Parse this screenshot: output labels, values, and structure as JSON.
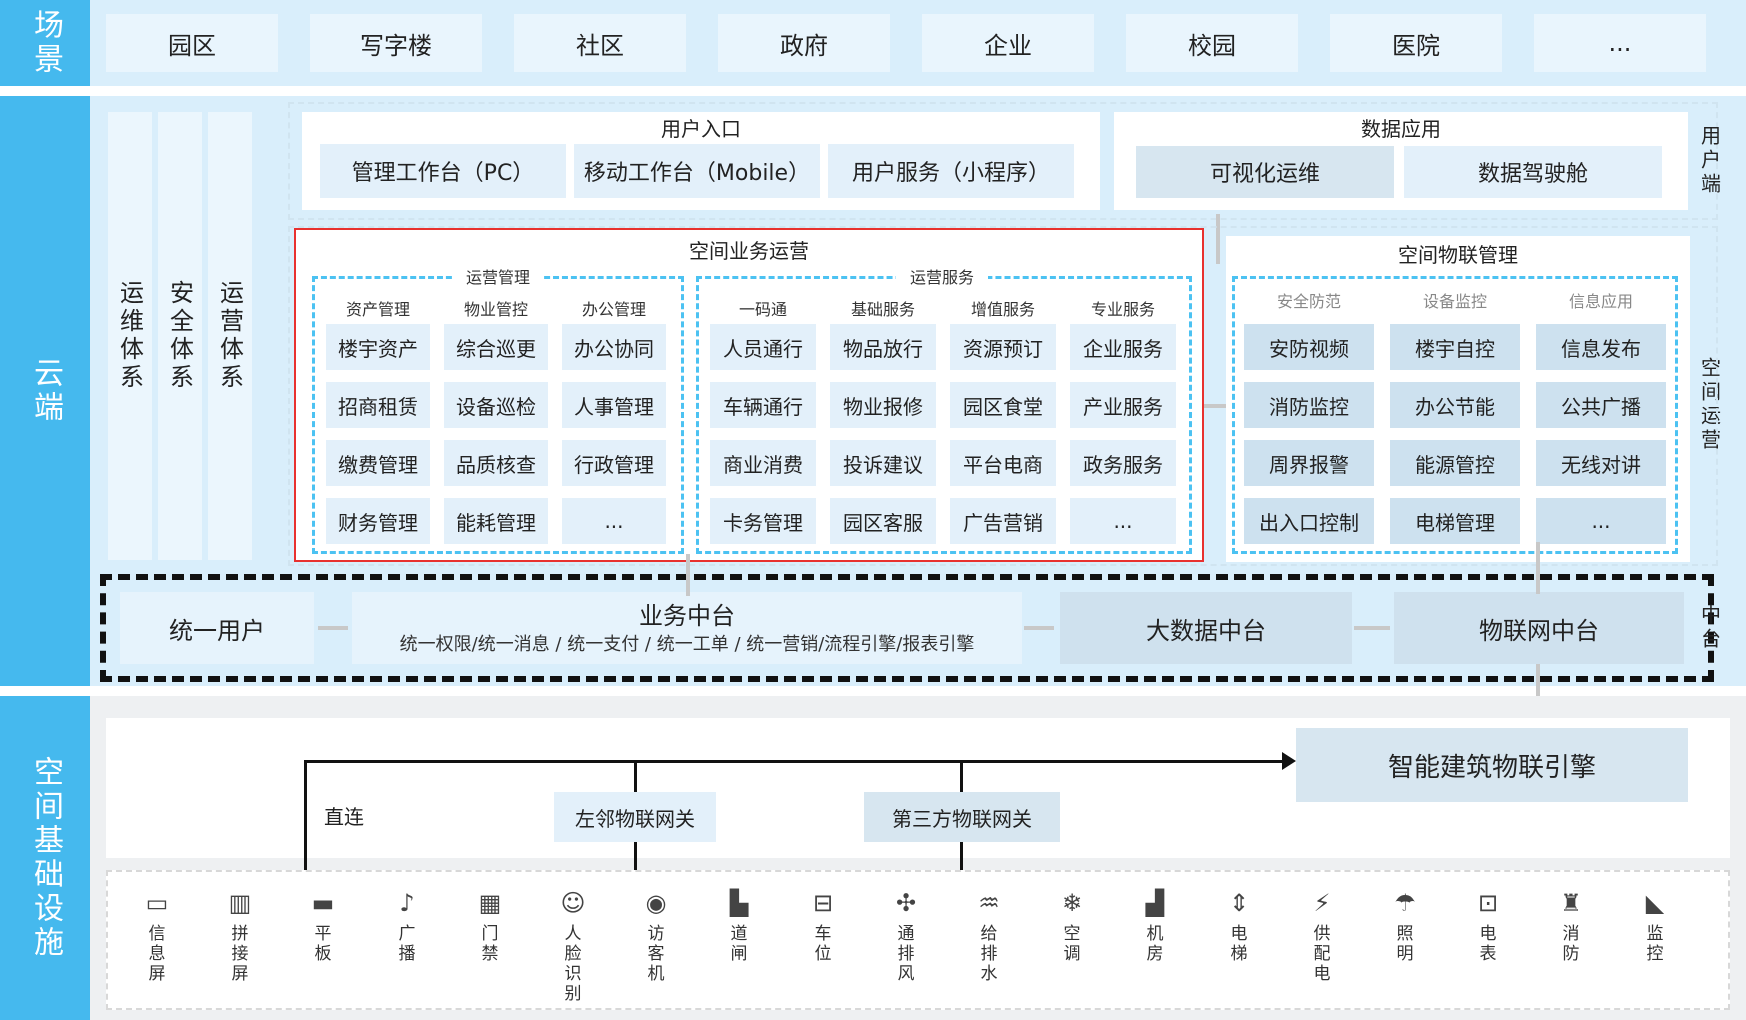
{
  "categories": {
    "scene": "场景",
    "cloud": "云端",
    "infra": "空间基础设施"
  },
  "scenes": [
    "园区",
    "写字楼",
    "社区",
    "政府",
    "企业",
    "校园",
    "医院",
    "..."
  ],
  "systems": [
    "运维体系",
    "安全体系",
    "运营体系"
  ],
  "user_entry": {
    "title": "用户入口",
    "items": [
      "管理工作台（PC）",
      "移动工作台（Mobile）",
      "用户服务（小程序）"
    ]
  },
  "data_app": {
    "title": "数据应用",
    "items": [
      "可视化运维",
      "数据驾驶舱"
    ]
  },
  "side_labels": {
    "user_end": "用户端",
    "space_ops": "空间运营",
    "middle": "中台"
  },
  "space_business": {
    "title": "空间业务运营",
    "ops_mgmt": {
      "title": "运营管理",
      "columns": [
        {
          "header": "资产管理",
          "items": [
            "楼宇资产",
            "招商租赁",
            "缴费管理",
            "财务管理"
          ]
        },
        {
          "header": "物业管控",
          "items": [
            "综合巡更",
            "设备巡检",
            "品质核查",
            "能耗管理"
          ]
        },
        {
          "header": "办公管理",
          "items": [
            "办公协同",
            "人事管理",
            "行政管理",
            "..."
          ]
        }
      ]
    },
    "ops_service": {
      "title": "运营服务",
      "columns": [
        {
          "header": "一码通",
          "items": [
            "人员通行",
            "车辆通行",
            "商业消费",
            "卡务管理"
          ]
        },
        {
          "header": "基础服务",
          "items": [
            "物品放行",
            "物业报修",
            "投诉建议",
            "园区客服"
          ]
        },
        {
          "header": "增值服务",
          "items": [
            "资源预订",
            "园区食堂",
            "平台电商",
            "广告营销"
          ]
        },
        {
          "header": "专业服务",
          "items": [
            "企业服务",
            "产业服务",
            "政务服务",
            "..."
          ]
        }
      ]
    }
  },
  "iot_mgmt": {
    "title": "空间物联管理",
    "columns": [
      {
        "header": "安全防范",
        "items": [
          "安防视频",
          "消防监控",
          "周界报警",
          "出入口控制"
        ]
      },
      {
        "header": "设备监控",
        "items": [
          "楼宇自控",
          "办公节能",
          "能源管控",
          "电梯管理"
        ]
      },
      {
        "header": "信息应用",
        "items": [
          "信息发布",
          "公共广播",
          "无线对讲",
          "..."
        ]
      }
    ]
  },
  "middle": {
    "unified_user": "统一用户",
    "biz_title": "业务中台",
    "biz_sub": "统一权限/统一消息 / 统一支付 / 统一工单 / 统一营销/流程引擎/报表引擎",
    "bigdata": "大数据中台",
    "iot": "物联网中台"
  },
  "infra": {
    "engine": "智能建筑物联引擎",
    "direct": "直连",
    "gateway1": "左邻物联网关",
    "gateway2": "第三方物联网关"
  },
  "devices": [
    {
      "icon": "display-icon",
      "glyph": "▭",
      "label": "信息屏"
    },
    {
      "icon": "splice-screen-icon",
      "glyph": "▥",
      "label": "拼接屏"
    },
    {
      "icon": "tablet-icon",
      "glyph": "▬",
      "label": "平板"
    },
    {
      "icon": "broadcast-icon",
      "glyph": "♪",
      "label": "广播"
    },
    {
      "icon": "access-control-icon",
      "glyph": "▦",
      "label": "门禁"
    },
    {
      "icon": "face-recognition-icon",
      "glyph": "☺",
      "label": "人脸识别"
    },
    {
      "icon": "visitor-machine-icon",
      "glyph": "◉",
      "label": "访客机"
    },
    {
      "icon": "gate-icon",
      "glyph": "▙",
      "label": "道闸"
    },
    {
      "icon": "parking-icon",
      "glyph": "⊟",
      "label": "车位"
    },
    {
      "icon": "ventilation-icon",
      "glyph": "✣",
      "label": "通排风"
    },
    {
      "icon": "water-pump-icon",
      "glyph": "♒",
      "label": "给排水"
    },
    {
      "icon": "air-conditioner-icon",
      "glyph": "❄",
      "label": "空调"
    },
    {
      "icon": "machine-room-icon",
      "glyph": "▟",
      "label": "机房"
    },
    {
      "icon": "elevator-icon",
      "glyph": "⇕",
      "label": "电梯"
    },
    {
      "icon": "power-supply-icon",
      "glyph": "⚡",
      "label": "供配电"
    },
    {
      "icon": "lighting-icon",
      "glyph": "☂",
      "label": "照明"
    },
    {
      "icon": "meter-icon",
      "glyph": "⊡",
      "label": "电表"
    },
    {
      "icon": "fire-hydrant-icon",
      "glyph": "♜",
      "label": "消防"
    },
    {
      "icon": "surveillance-camera-icon",
      "glyph": "◣",
      "label": "监控"
    }
  ],
  "colors": {
    "category_blue": "#45b9ee",
    "highlight_red": "#e8312f",
    "dash_blue": "#4cc2f2"
  }
}
